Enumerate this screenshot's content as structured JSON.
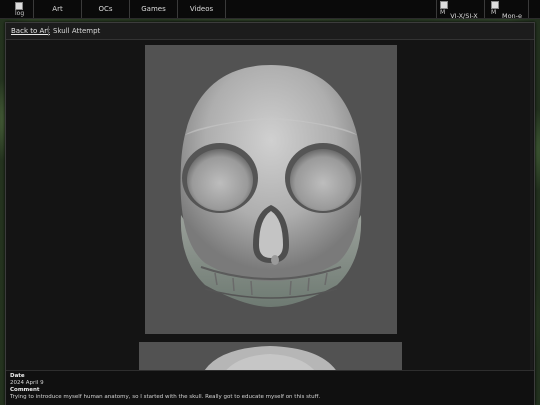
{
  "nav": {
    "logo_alt": "log",
    "items": [
      "Art",
      "OCs",
      "Games",
      "Videos"
    ],
    "right_images": [
      {
        "alt_top": "M",
        "alt_bottom": "icc",
        "label": "VI-X/SI-X"
      },
      {
        "alt_top": "M",
        "alt_bottom": "icc",
        "label": "Mon-e"
      }
    ]
  },
  "breadcrumb": {
    "back": "Back to Art",
    "title": "Skull Attempt"
  },
  "info": {
    "date_label": "Date",
    "date_value": "2024 April 9",
    "comment_label": "Comment",
    "comment_value": "Trying to introduce myself human anatomy, so I started with the skull. Really got to educate myself on this stuff."
  },
  "colors": {
    "panel_bg": "#525252",
    "skull": "#b8b8b8",
    "nav_bg": "#0a0a0a"
  }
}
